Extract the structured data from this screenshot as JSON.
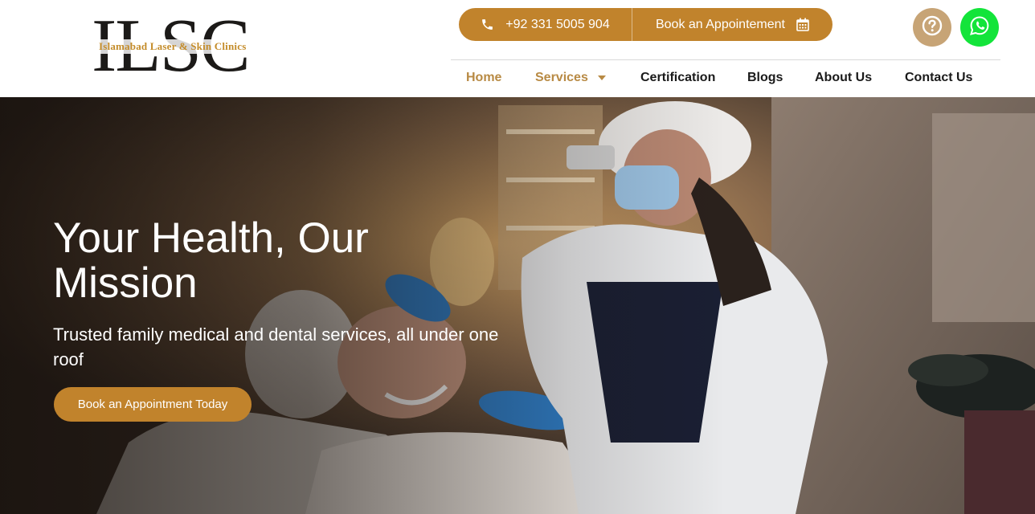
{
  "brand": {
    "logo_letters": "ILSC",
    "logo_tagline": "Islamabad Laser & Skin Clinics"
  },
  "header_cta": {
    "phone_label": "+92 331 5005 904",
    "phone_icon": "phone-icon",
    "book_label": "Book an Appointement",
    "book_icon": "calendar-icon"
  },
  "quick_actions": {
    "help_icon": "question-icon",
    "whatsapp_icon": "whatsapp-icon"
  },
  "nav": {
    "items": [
      {
        "label": "Home",
        "active": true
      },
      {
        "label": "Services",
        "has_dropdown": true
      },
      {
        "label": "Certification"
      },
      {
        "label": "Blogs"
      },
      {
        "label": "About Us"
      },
      {
        "label": "Contact Us"
      }
    ]
  },
  "hero": {
    "title": "Your Health, Our Mission",
    "subtitle": "Trusted family medical and dental services, all under one roof",
    "cta_label": "Book an Appointment Today"
  },
  "colors": {
    "accent": "#c1832c",
    "nav_active": "#b88a44",
    "help_button": "#c7a476",
    "whatsapp_green": "#13e43a"
  }
}
